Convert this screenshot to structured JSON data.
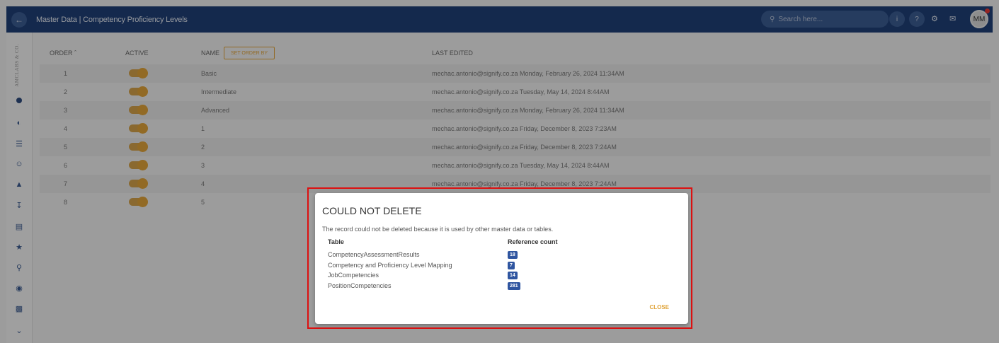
{
  "header": {
    "title": "Master Data | Competency Proficiency Levels",
    "search_placeholder": "Search here...",
    "avatar_initials": "MM"
  },
  "sidebar": {
    "logo_text": "AMCLABS & CO."
  },
  "table": {
    "columns": [
      "ORDER",
      "ACTIVE",
      "NAME",
      "LAST EDITED"
    ],
    "set_order_label": "SET ORDER BY",
    "rows": [
      {
        "order": "1",
        "name": "Basic",
        "last_edited": "mechac.antonio@signify.co.za Monday, February 26, 2024 11:34AM"
      },
      {
        "order": "2",
        "name": "Intermediate",
        "last_edited": "mechac.antonio@signify.co.za Tuesday, May 14, 2024 8:44AM"
      },
      {
        "order": "3",
        "name": "Advanced",
        "last_edited": "mechac.antonio@signify.co.za Monday, February 26, 2024 11:34AM"
      },
      {
        "order": "4",
        "name": "1",
        "last_edited": "mechac.antonio@signify.co.za Friday, December 8, 2023 7:23AM"
      },
      {
        "order": "5",
        "name": "2",
        "last_edited": "mechac.antonio@signify.co.za Friday, December 8, 2023 7:24AM"
      },
      {
        "order": "6",
        "name": "3",
        "last_edited": "mechac.antonio@signify.co.za Tuesday, May 14, 2024 8:44AM"
      },
      {
        "order": "7",
        "name": "4",
        "last_edited": "mechac.antonio@signify.co.za Friday, December 8, 2023 7:24AM"
      },
      {
        "order": "8",
        "name": "5",
        "last_edited": ""
      }
    ]
  },
  "dialog": {
    "title": "COULD NOT DELETE",
    "message": "The record could not be deleted because it is used by other master data or tables.",
    "col_table": "Table",
    "col_count": "Reference count",
    "references": [
      {
        "table": "CompetencyAssessmentResults",
        "count": "18"
      },
      {
        "table": "Competency and Proficiency Level Mapping",
        "count": "7"
      },
      {
        "table": "JobCompetencies",
        "count": "14"
      },
      {
        "table": "PositionCompetencies",
        "count": "281"
      }
    ],
    "close_label": "CLOSE"
  }
}
